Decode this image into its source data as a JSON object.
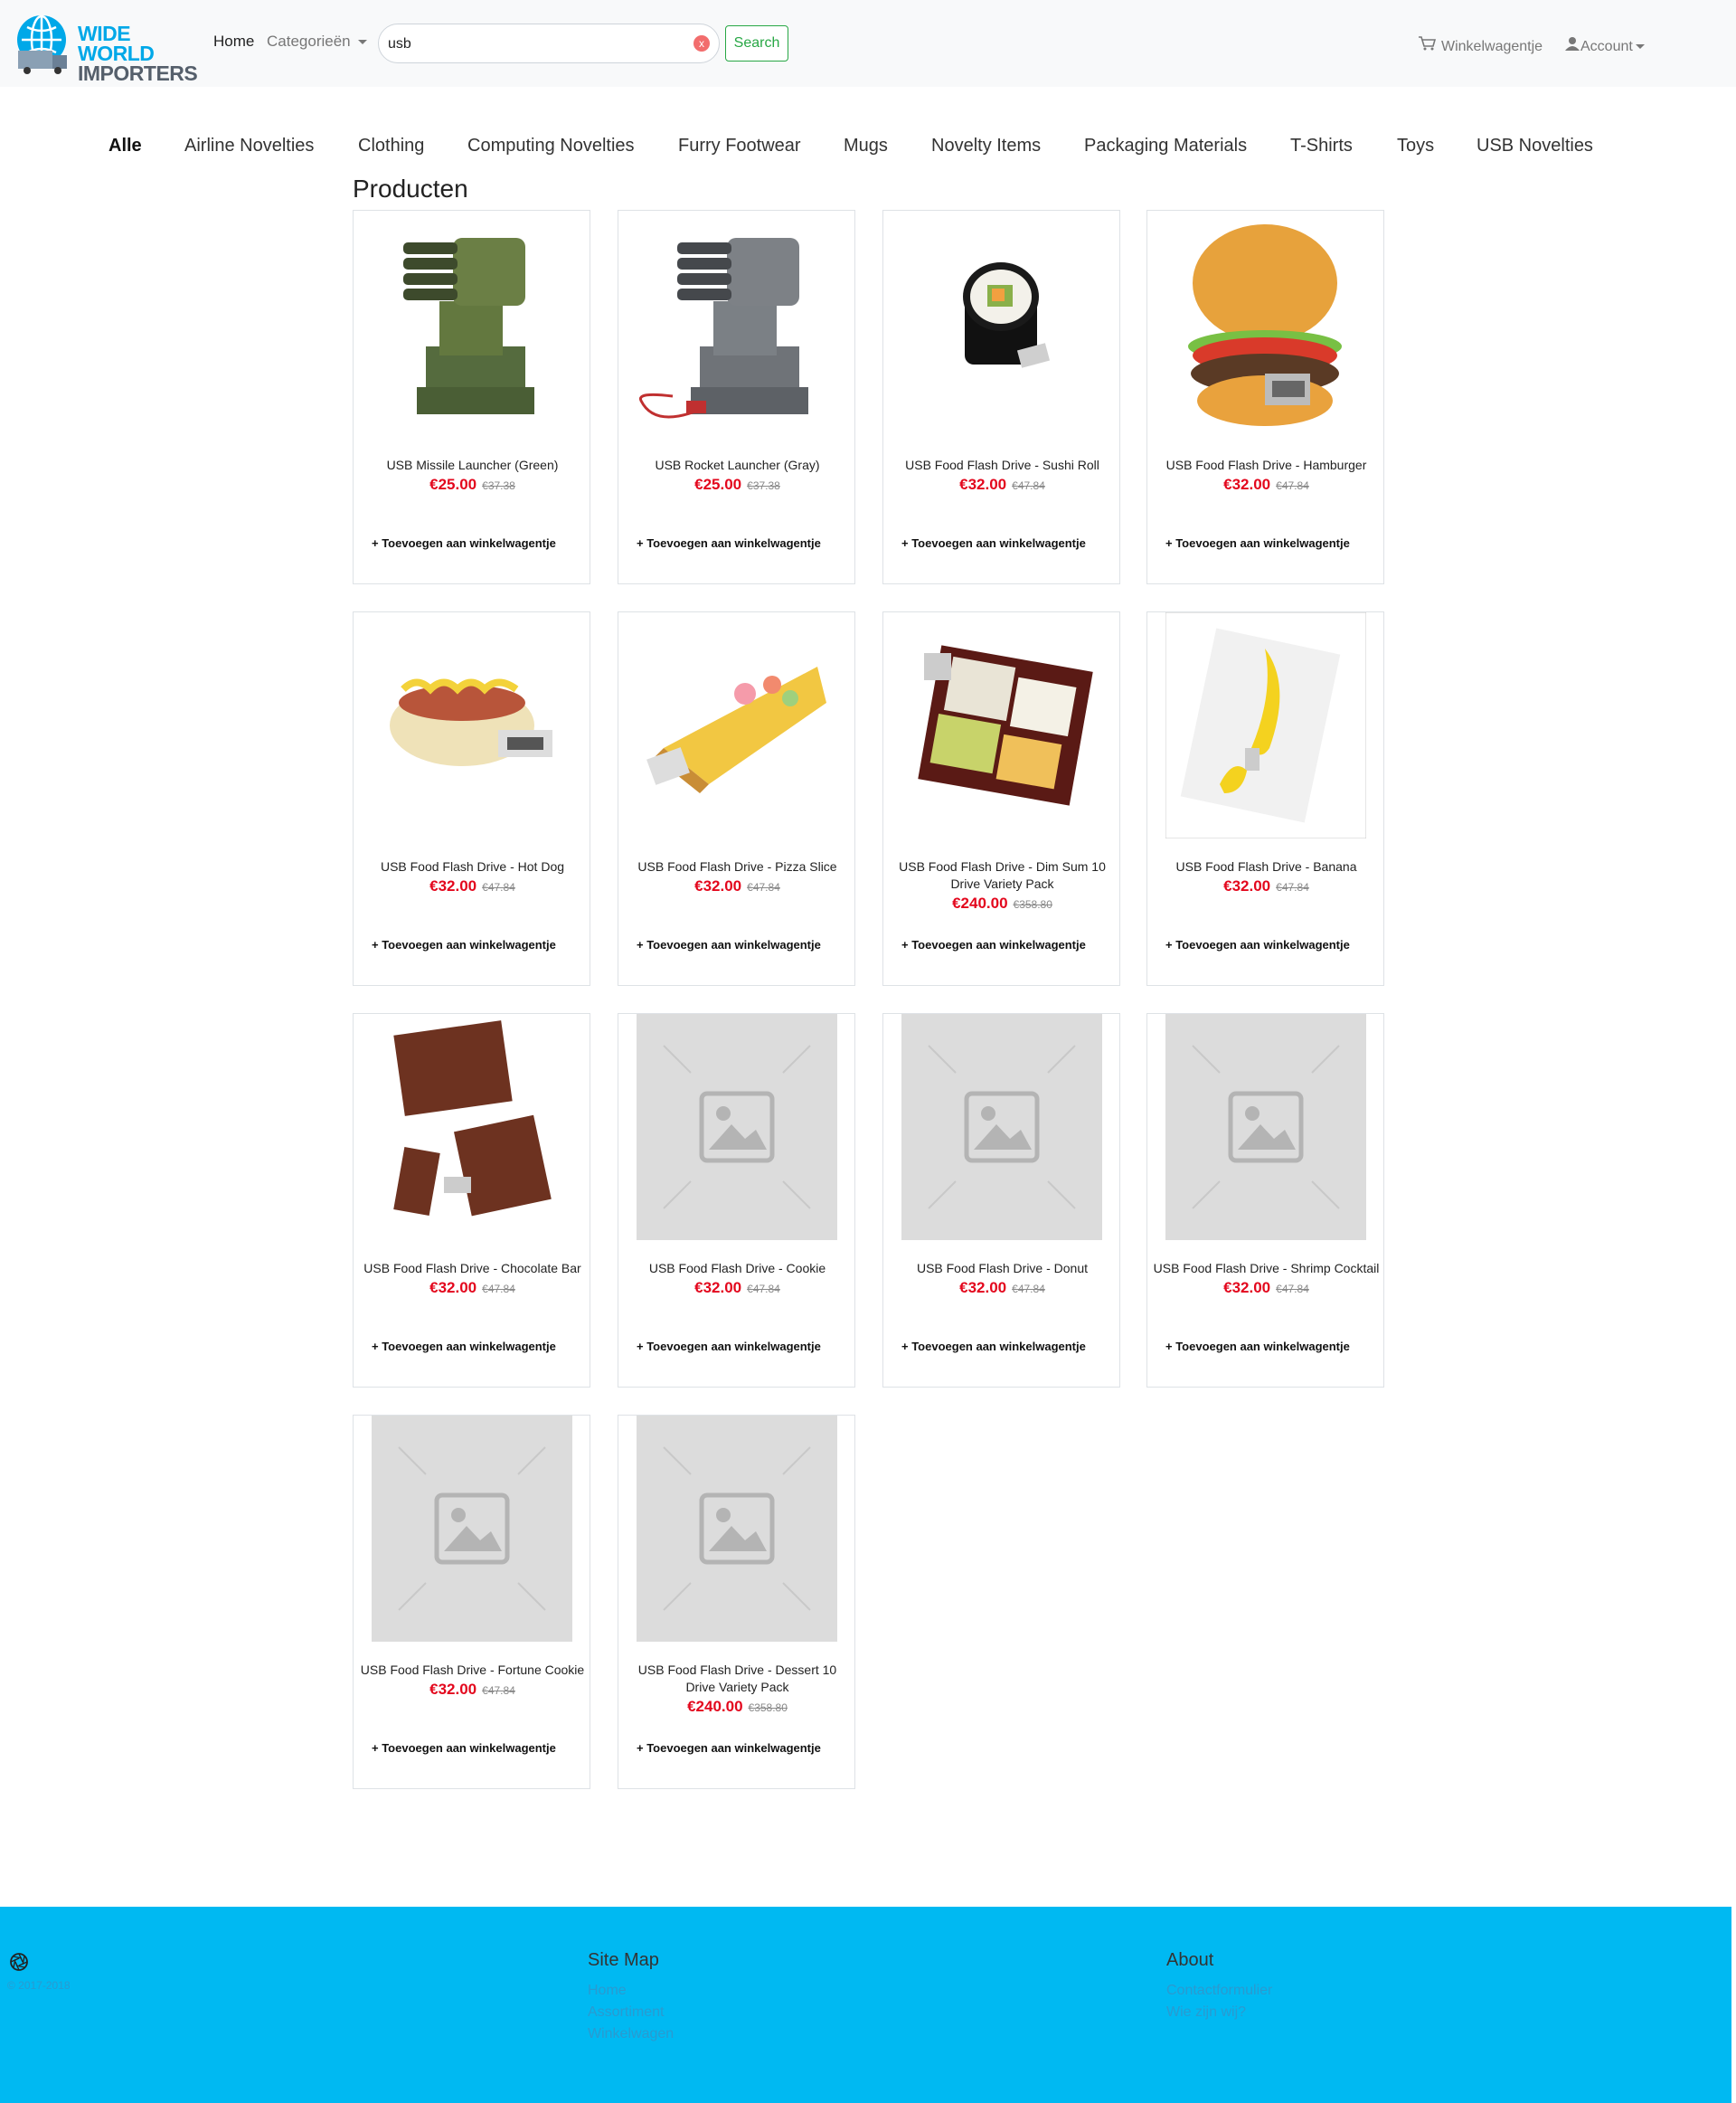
{
  "header": {
    "logo_line1": "WIDE WORLD",
    "logo_line2": "IMPORTERS",
    "home": "Home",
    "categories": "Categorieën",
    "search_value": "usb",
    "search_button": "Search",
    "cart": "Winkelwagentje",
    "account": "Account"
  },
  "category_tabs": [
    "Alle",
    "Airline Novelties",
    "Clothing",
    "Computing Novelties",
    "Furry Footwear",
    "Mugs",
    "Novelty Items",
    "Packaging Materials",
    "T-Shirts",
    "Toys",
    "USB Novelties"
  ],
  "section_title": "Producten",
  "add_to_cart_label": "+ Toevoegen aan winkelwagentje",
  "products": [
    {
      "name": "USB Missile Launcher (Green)",
      "price": "€25.00",
      "old_price": "€37.38"
    },
    {
      "name": "USB Rocket Launcher (Gray)",
      "price": "€25.00",
      "old_price": "€37.38"
    },
    {
      "name": "USB Food Flash Drive - Sushi Roll",
      "price": "€32.00",
      "old_price": "€47.84"
    },
    {
      "name": "USB Food Flash Drive - Hamburger",
      "price": "€32.00",
      "old_price": "€47.84"
    },
    {
      "name": "USB Food Flash Drive - Hot Dog",
      "price": "€32.00",
      "old_price": "€47.84"
    },
    {
      "name": "USB Food Flash Drive - Pizza Slice",
      "price": "€32.00",
      "old_price": "€47.84"
    },
    {
      "name": "USB Food Flash Drive - Dim Sum 10 Drive Variety Pack",
      "price": "€240.00",
      "old_price": "€358.80"
    },
    {
      "name": "USB Food Flash Drive - Banana",
      "price": "€32.00",
      "old_price": "€47.84"
    },
    {
      "name": "USB Food Flash Drive - Chocolate Bar",
      "price": "€32.00",
      "old_price": "€47.84"
    },
    {
      "name": "USB Food Flash Drive - Cookie",
      "price": "€32.00",
      "old_price": "€47.84"
    },
    {
      "name": "USB Food Flash Drive - Donut",
      "price": "€32.00",
      "old_price": "€47.84"
    },
    {
      "name": "USB Food Flash Drive - Shrimp Cocktail",
      "price": "€32.00",
      "old_price": "€47.84"
    },
    {
      "name": "USB Food Flash Drive - Fortune Cookie",
      "price": "€32.00",
      "old_price": "€47.84"
    },
    {
      "name": "USB Food Flash Drive - Dessert 10 Drive Variety Pack",
      "price": "€240.00",
      "old_price": "€358.80"
    }
  ],
  "footer": {
    "copyright": "© 2017-2018",
    "sitemap_title": "Site Map",
    "sitemap_links": [
      "Home",
      "Assortiment",
      "Winkelwagen"
    ],
    "about_title": "About",
    "about_links": [
      "Contactformulier",
      "Wie zijn wij?"
    ]
  },
  "colors": {
    "brand": "#00b9f2",
    "price": "#e3071d",
    "search_button": "#28a745"
  }
}
